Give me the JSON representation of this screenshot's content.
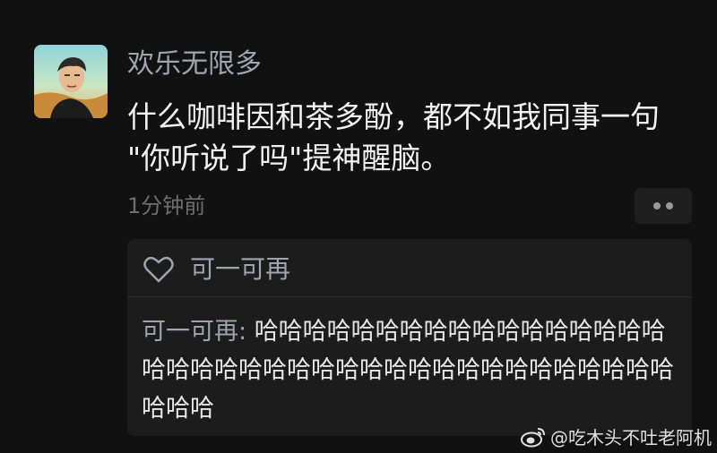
{
  "post": {
    "username": "欢乐无限多",
    "text_line1": "什么咖啡因和茶多酚，都不如我同事一句",
    "text_line2": "\"你听说了吗\"提神醒脑。",
    "timestamp": "1分钟前",
    "more_icon": "more-dots-icon"
  },
  "likes": {
    "icon": "heart-icon",
    "name": "可一可再"
  },
  "comment": {
    "author": "可一可再",
    "separator": ": ",
    "text": "哈哈哈哈哈哈哈哈哈哈哈哈哈哈哈哈哈哈哈哈哈哈哈哈哈哈哈哈哈哈哈哈哈哈哈哈哈哈哈哈哈哈"
  },
  "watermark": {
    "icon": "weibo-icon",
    "text": "@吃木头不吐老阿机"
  },
  "colors": {
    "background": "#111111",
    "name_text": "#9ea5b0",
    "body_text": "#f2f2f2",
    "meta_text": "#6e6e6e",
    "comment_box": "#1c1c1c"
  }
}
